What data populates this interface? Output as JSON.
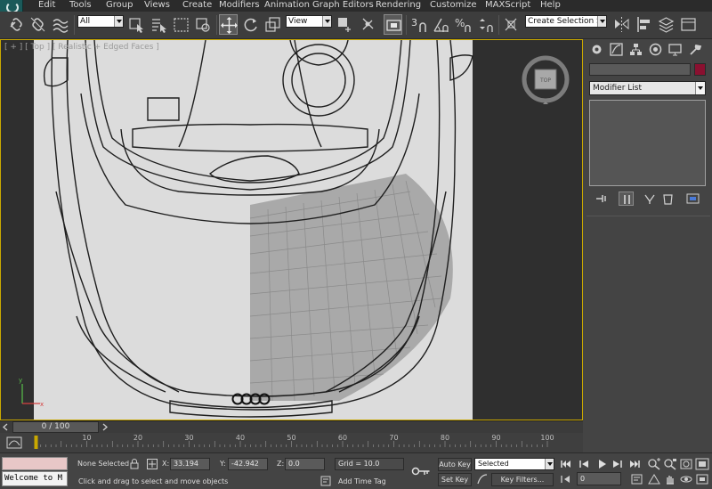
{
  "menu": {
    "items": [
      "Edit",
      "Tools",
      "Group",
      "Views",
      "Create",
      "Modifiers",
      "Animation",
      "Graph Editors",
      "Rendering",
      "Customize",
      "MAXScript",
      "Help"
    ]
  },
  "toolbar": {
    "selection_filter": "All",
    "reference_coord": "View",
    "named_selection": "Create Selection Se",
    "snap_label": "3",
    "icons": [
      "link-icon",
      "unlink-icon",
      "bind-space-warp-icon",
      "select-object-icon",
      "select-by-name-icon",
      "rectangular-selection-icon",
      "window-crossing-icon",
      "select-move-icon",
      "select-rotate-icon",
      "select-scale-icon",
      "use-pivot-icon",
      "select-manipulate-icon",
      "keyboard-shortcut-icon",
      "snap-toggle-icon",
      "angle-snap-icon",
      "percent-snap-icon",
      "spinner-snap-icon",
      "edit-named-selection-icon",
      "mirror-icon",
      "align-icon",
      "layer-manager-icon",
      "graphite-ribbon-icon",
      "curve-editor-icon",
      "schematic-view-icon",
      "material-editor-icon",
      "render-setup-icon",
      "rendered-frame-icon",
      "render-production-icon"
    ]
  },
  "viewport": {
    "label": "[ + ] [ Top ] [ Realistic + Edged Faces ]",
    "viewcube_label": "TOP"
  },
  "command_panel": {
    "tabs": [
      "create-tab",
      "modify-tab",
      "hierarchy-tab",
      "motion-tab",
      "display-tab",
      "utilities-tab"
    ],
    "object_color": "#8a1030",
    "modifier_list": "Modifier List"
  },
  "timeline": {
    "frame_display": "0 / 100",
    "ticks": [
      "10",
      "20",
      "30",
      "40",
      "50",
      "60",
      "70",
      "80",
      "90",
      "100"
    ],
    "current_frame": 0,
    "total_frames": 100
  },
  "status": {
    "maxscript_output": "Welcome to M",
    "selection_info": "None Selected",
    "prompt": "Click and drag to select and move objects",
    "x_label": "X:",
    "x_value": "33.194",
    "y_label": "Y:",
    "y_value": "-42.942",
    "z_label": "Z:",
    "z_value": "0.0",
    "grid": "Grid = 10.0",
    "add_time_tag": "Add Time Tag",
    "auto_key": "Auto Key",
    "set_key": "Set Key",
    "key_mode": "Selected",
    "key_filters": "Key Filters...",
    "frame_value": "0"
  }
}
